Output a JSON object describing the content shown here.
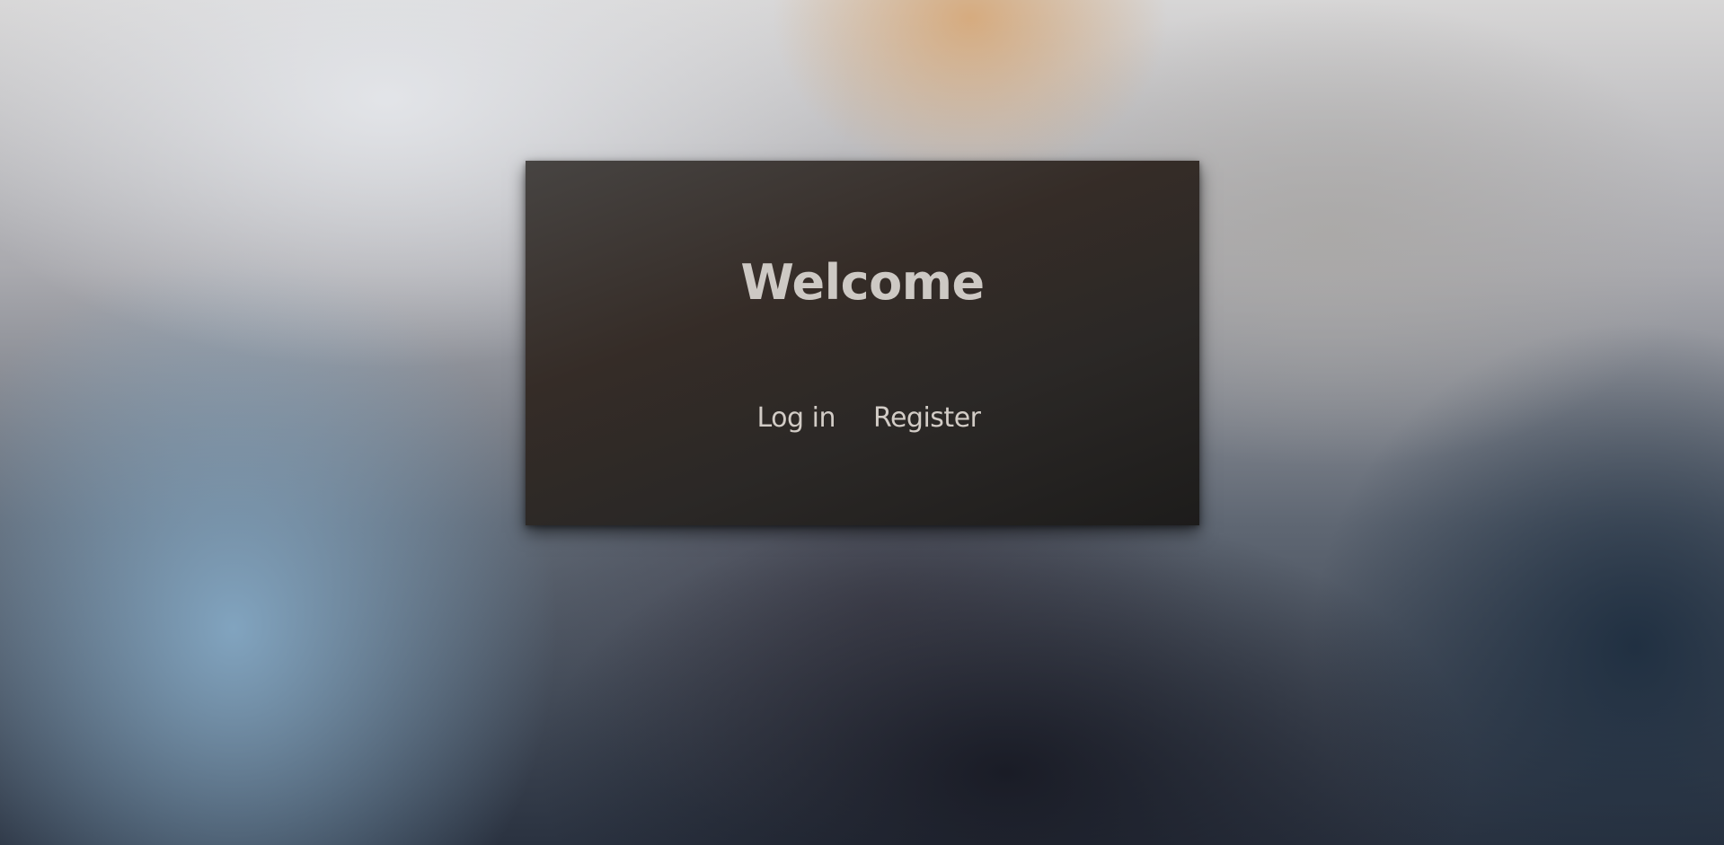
{
  "page": {
    "title": "Welcome"
  },
  "nav": {
    "login_label": "Log in",
    "register_label": "Register"
  },
  "colors": {
    "panel_bg": "#2d2926",
    "title_text": "#cdc9c4",
    "link_text": "#d2ccc6"
  }
}
